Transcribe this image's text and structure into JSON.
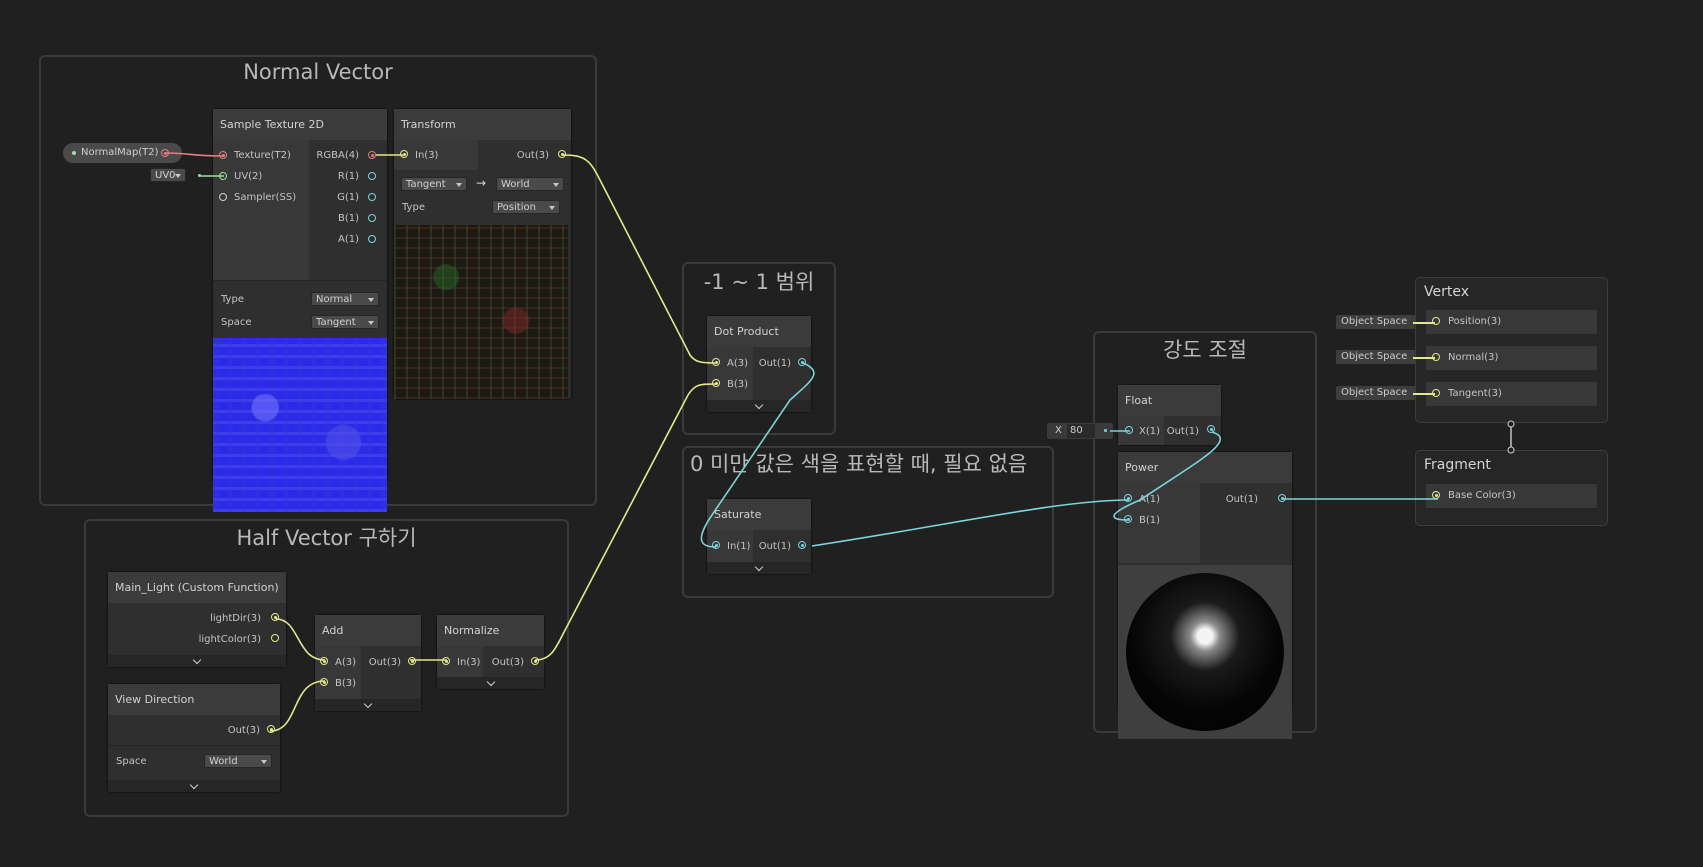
{
  "groups": {
    "normal_vector": "Normal Vector",
    "half_vector": "Half Vector 구하기",
    "range": "-1 ~ 1 범위",
    "saturate_note": "0 미만 값은 색을 표현할 때, 필요 없음",
    "intensity": "강도 조절"
  },
  "normalmap_prop": {
    "label": "NormalMap(T2)"
  },
  "uv_select": "UV0",
  "sample_texture": {
    "title": "Sample Texture 2D",
    "inputs": [
      "Texture(T2)",
      "UV(2)",
      "Sampler(SS)"
    ],
    "outputs": [
      "RGBA(4)",
      "R(1)",
      "G(1)",
      "B(1)",
      "A(1)"
    ],
    "type_label": "Type",
    "type_value": "Normal",
    "space_label": "Space",
    "space_value": "Tangent"
  },
  "transform": {
    "title": "Transform",
    "input": "In(3)",
    "output": "Out(3)",
    "from": "Tangent",
    "arrow": "→",
    "to": "World",
    "type_label": "Type",
    "type_value": "Position"
  },
  "dot_product": {
    "title": "Dot Product",
    "inputs": [
      "A(3)",
      "B(3)"
    ],
    "output": "Out(1)"
  },
  "saturate": {
    "title": "Saturate",
    "input": "In(1)",
    "output": "Out(1)"
  },
  "main_light": {
    "title": "Main_Light (Custom Function)",
    "outputs": [
      "lightDir(3)",
      "lightColor(3)"
    ]
  },
  "view_direction": {
    "title": "View Direction",
    "output": "Out(3)",
    "space_label": "Space",
    "space_value": "World"
  },
  "add": {
    "title": "Add",
    "inputs": [
      "A(3)",
      "B(3)"
    ],
    "output": "Out(3)"
  },
  "normalize": {
    "title": "Normalize",
    "input": "In(3)",
    "output": "Out(3)"
  },
  "float_node": {
    "title": "Float",
    "input": "X(1)",
    "output": "Out(1)",
    "field_label": "X",
    "field_value": "80"
  },
  "power": {
    "title": "Power",
    "inputs": [
      "A(1)",
      "B(1)"
    ],
    "output": "Out(1)"
  },
  "vertex": {
    "title": "Vertex",
    "slots": [
      {
        "tag": "Object Space",
        "label": "Position(3)"
      },
      {
        "tag": "Object Space",
        "label": "Normal(3)"
      },
      {
        "tag": "Object Space",
        "label": "Tangent(3)"
      }
    ]
  },
  "fragment": {
    "title": "Fragment",
    "slots": [
      {
        "label": "Base Color(3)"
      }
    ]
  },
  "colors": {
    "background": "#202020",
    "wire_vector3": "#e4e88c",
    "wire_float": "#7bd5dc",
    "wire_texture": "#e27e7e"
  }
}
